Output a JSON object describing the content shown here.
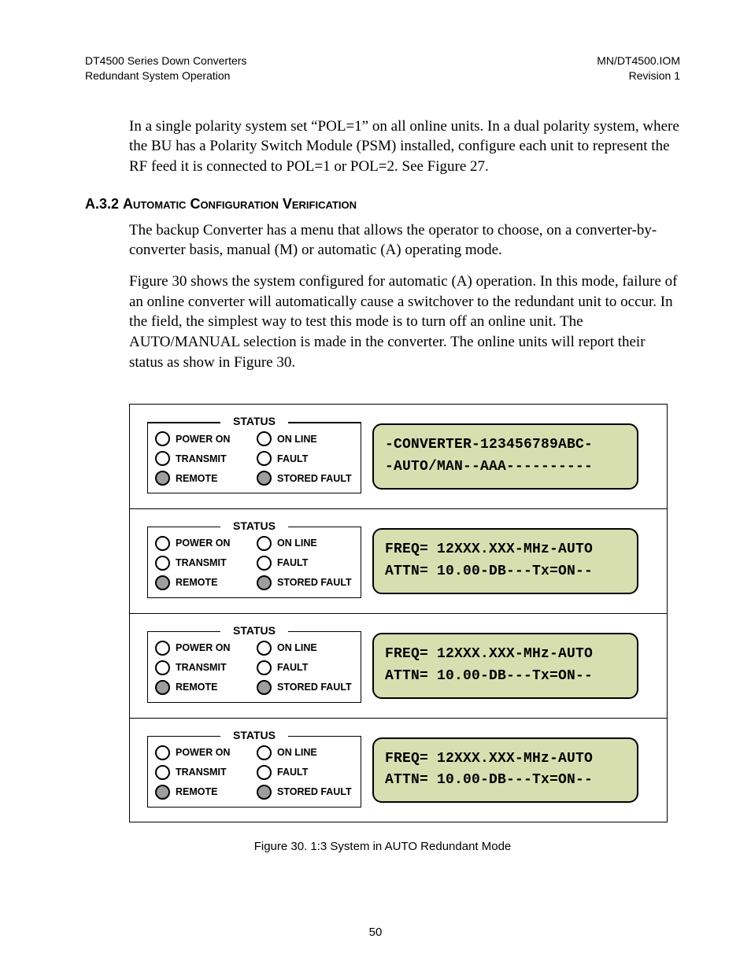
{
  "header": {
    "left_line1": "DT4500 Series Down Converters",
    "left_line2": "Redundant System Operation",
    "right_line1": "MN/DT4500.IOM",
    "right_line2": "Revision 1"
  },
  "intro_para": "In a single polarity system set “POL=1” on all online units. In a dual polarity system, where the BU has a Polarity Switch Module (PSM) installed, configure each unit to represent the RF feed it is connected to POL=1 or POL=2. See Figure 27.",
  "section": {
    "number": "A.3.2",
    "title_sc": "Automatic Configuration Verification"
  },
  "para1": "The backup Converter has a menu that allows the operator to choose, on a converter-by-converter basis, manual (M) or automatic (A) operating mode.",
  "para2": "Figure 30 shows the system configured for automatic (A) operation.  In this mode, failure of an online converter will automatically cause a switchover to the redundant unit to occur.  In the field, the simplest way to test this mode is to turn off an online unit. The AUTO/MANUAL selection is made in the converter. The online units will report their status as show in Figure 30.",
  "status_labels": {
    "title": "STATUS",
    "power_on": "POWER ON",
    "on_line": "ON LINE",
    "transmit": "TRANSMIT",
    "fault": "FAULT",
    "remote": "REMOTE",
    "stored_fault": "STORED FAULT"
  },
  "units": [
    {
      "display_line1": "-CONVERTER-123456789ABC-",
      "display_line2": "-AUTO/MAN--AAA----------"
    },
    {
      "display_line1": "FREQ= 12XXX.XXX-MHz-AUTO",
      "display_line2": "ATTN= 10.00-DB---Tx=ON--"
    },
    {
      "display_line1": "FREQ= 12XXX.XXX-MHz-AUTO",
      "display_line2": "ATTN= 10.00-DB---Tx=ON--"
    },
    {
      "display_line1": "FREQ= 12XXX.XXX-MHz-AUTO",
      "display_line2": "ATTN= 10.00-DB---Tx=ON--"
    }
  ],
  "figure_caption": "Figure 30.  1:3 System in AUTO Redundant Mode",
  "page_number": "50"
}
